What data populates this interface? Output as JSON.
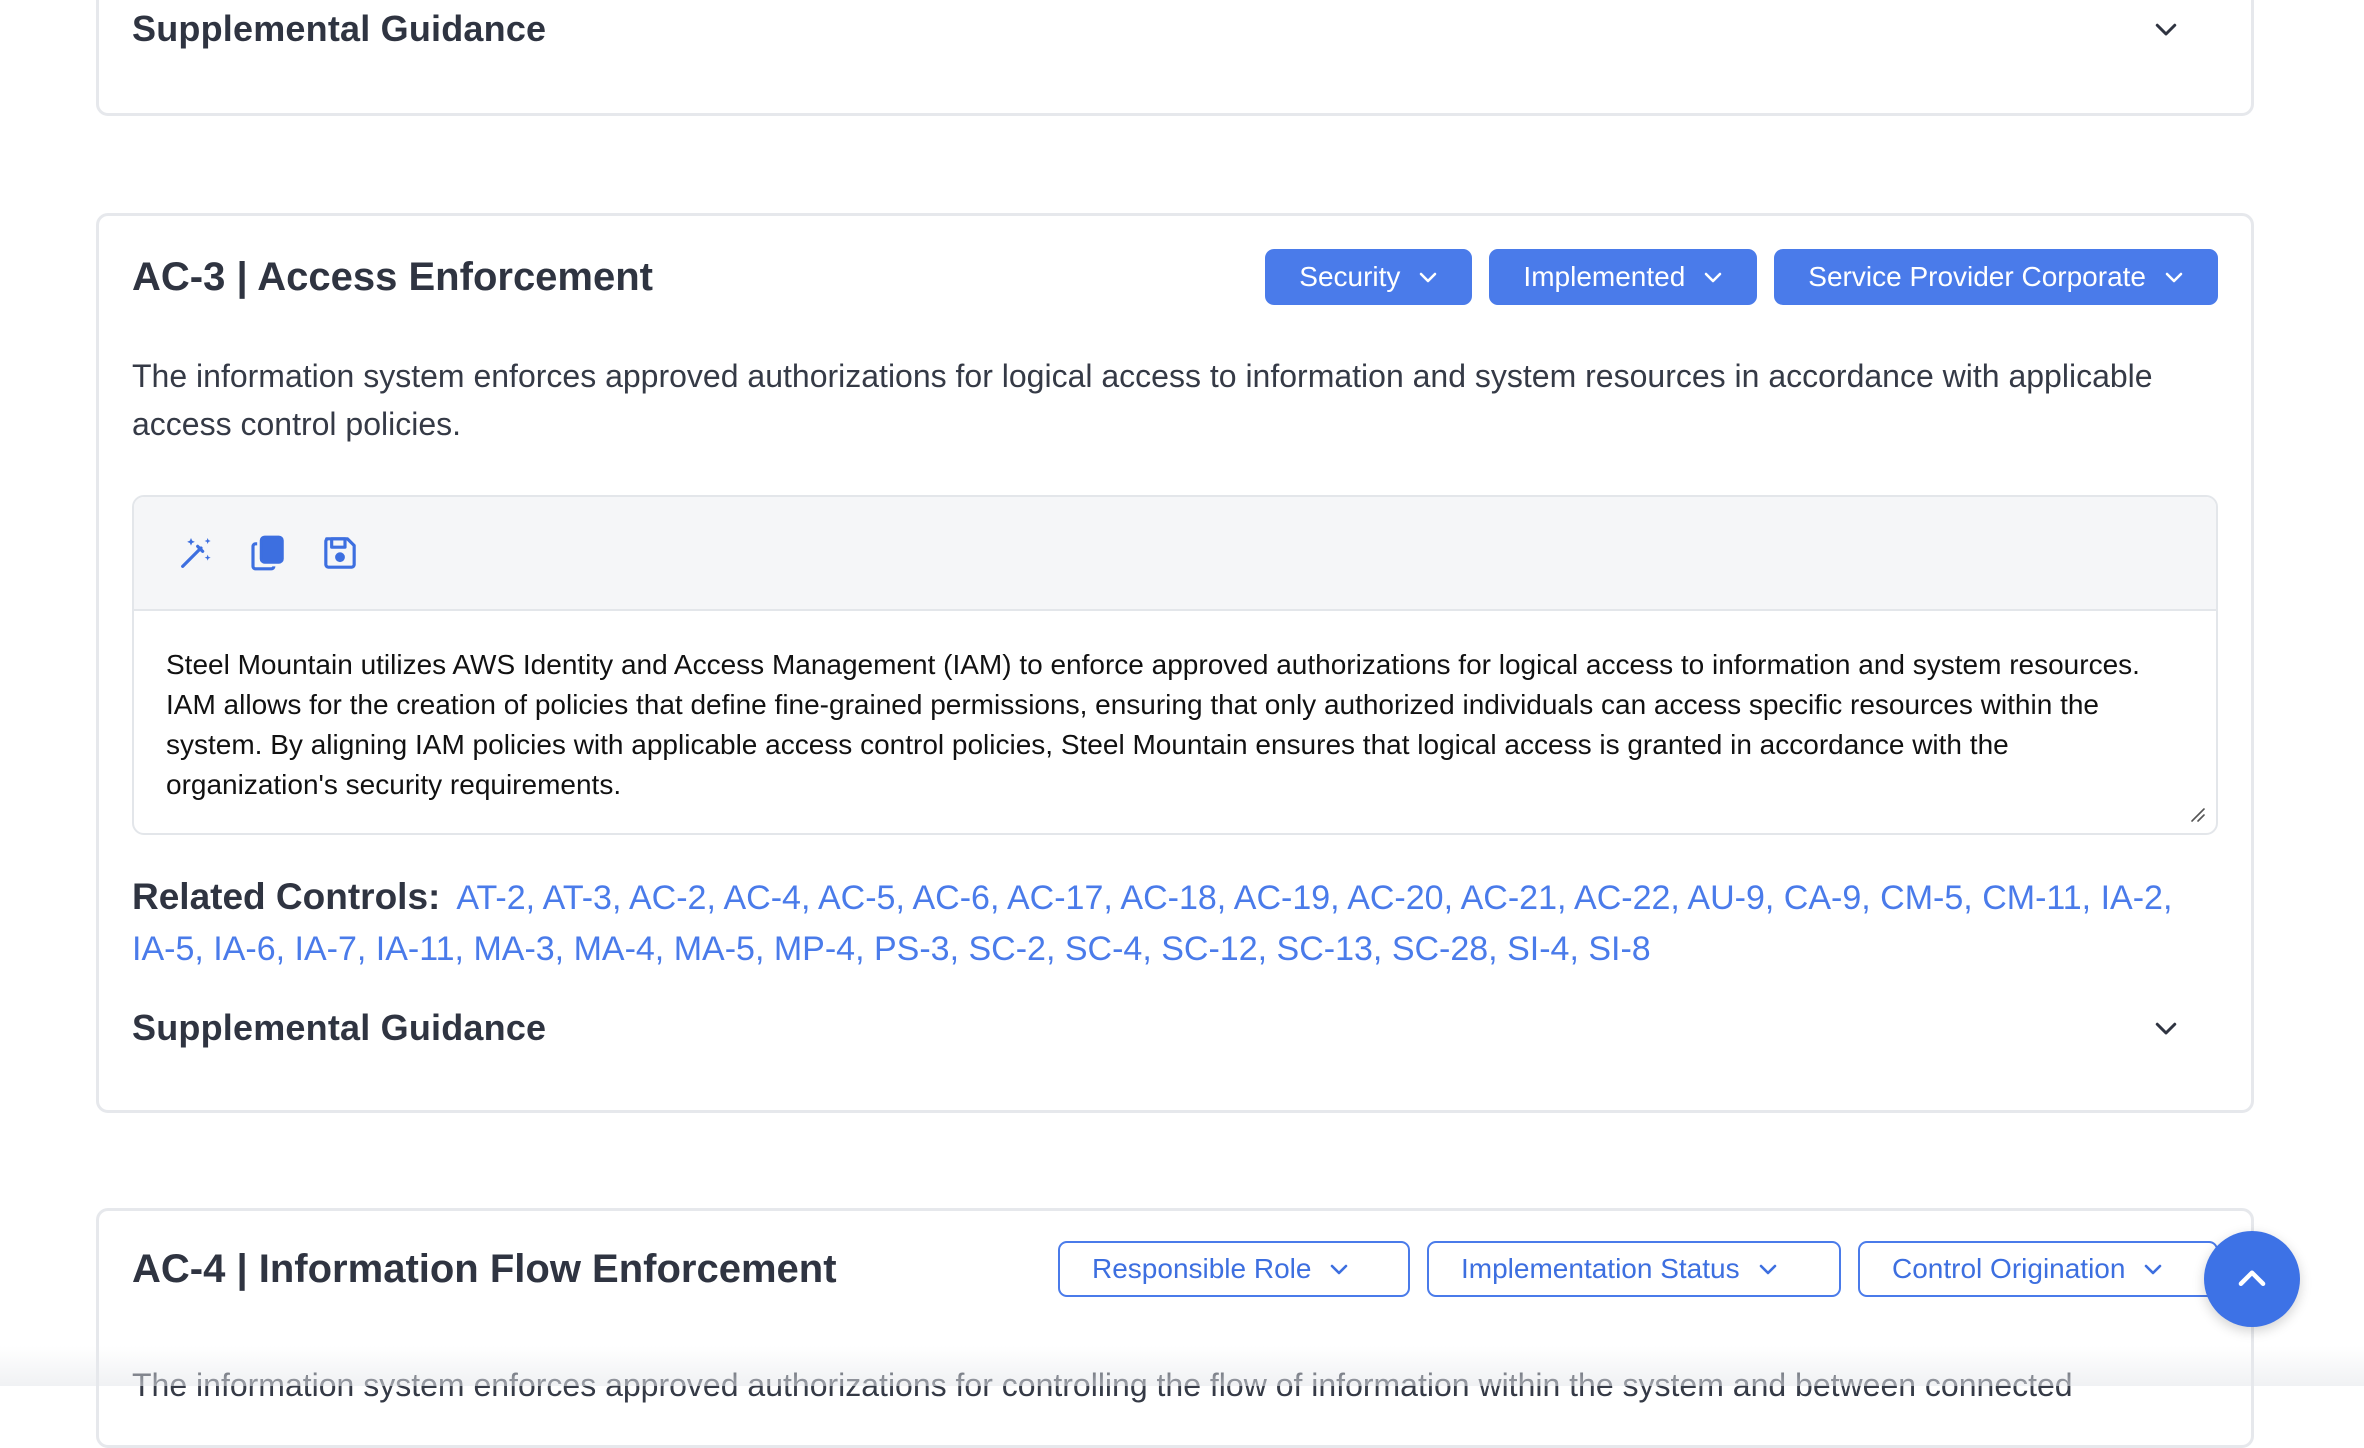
{
  "top_card": {
    "supplemental_title": "Supplemental Guidance"
  },
  "ac3": {
    "title": "AC-3 | Access Enforcement",
    "pills": {
      "role": "Security",
      "status": "Implemented",
      "origination": "Service Provider Corporate"
    },
    "description": "The information system enforces approved authorizations for logical access to information and system resources in accordance with applicable access control policies.",
    "toolbar": {
      "icons": [
        "magic-wand-icon",
        "copy-icon",
        "save-icon"
      ]
    },
    "implementation_text": "Steel Mountain utilizes AWS Identity and Access Management (IAM) to enforce approved authorizations for logical access to information and system resources. IAM allows for the creation of policies that define fine-grained permissions, ensuring that only authorized individuals can access specific resources within the system. By aligning IAM policies with applicable access control policies, Steel Mountain ensures that logical access is granted in accordance with the organization's security requirements.",
    "related_label": "Related Controls:",
    "related_controls": [
      "AT-2",
      "AT-3",
      "AC-2",
      "AC-4",
      "AC-5",
      "AC-6",
      "AC-17",
      "AC-18",
      "AC-19",
      "AC-20",
      "AC-21",
      "AC-22",
      "AU-9",
      "CA-9",
      "CM-5",
      "CM-11",
      "IA-2",
      "IA-5",
      "IA-6",
      "IA-7",
      "IA-11",
      "MA-3",
      "MA-4",
      "MA-5",
      "MP-4",
      "PS-3",
      "SC-2",
      "SC-4",
      "SC-12",
      "SC-13",
      "SC-28",
      "SI-4",
      "SI-8"
    ],
    "supplemental_title": "Supplemental Guidance"
  },
  "ac4": {
    "title": "AC-4 | Information Flow Enforcement",
    "pills": {
      "role": "Responsible Role",
      "status": "Implementation Status",
      "origination": "Control Origination"
    },
    "description": "The information system enforces approved authorizations for controlling the flow of information within the system and between connected"
  },
  "colors": {
    "accent": "#4a7bea",
    "scroll_button": "#3d72e6",
    "heading": "#2f3441"
  }
}
